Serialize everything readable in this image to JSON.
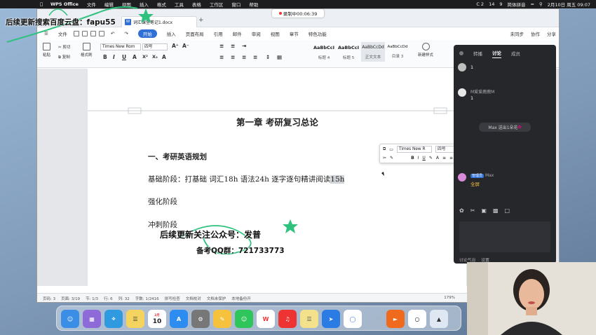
{
  "menubar": {
    "app": "WPS Office",
    "items": [
      "文件",
      "编辑",
      "视图",
      "插入",
      "格式",
      "工具",
      "表格",
      "工作区",
      "窗口",
      "帮助"
    ],
    "right": [
      "C 2",
      "14",
      "9",
      "简体拼音",
      "2月10日 周五 09:07"
    ]
  },
  "recording": "录制中00:06:39",
  "doc_tab": {
    "title": "词汇课堂笔记1.docx"
  },
  "toolbar": {
    "file": "文件",
    "start": "开始",
    "tabs": [
      "插入",
      "页面布局",
      "引用",
      "邮件",
      "审阅",
      "视图",
      "章节",
      "特色功能"
    ],
    "right": [
      "未同步",
      "协作",
      "分享"
    ]
  },
  "ribbon": {
    "paste": "粘贴",
    "cut": "剪切",
    "copy": "复制",
    "format_painter": "格式刷",
    "font": "Times New Rom",
    "size": "四号",
    "styles": [
      {
        "sample": "AaBbCcI",
        "name": "标题 4"
      },
      {
        "sample": "AaBbCcI",
        "name": "标题 5"
      },
      {
        "sample": "AaBbCcDd",
        "name": "正文文本"
      },
      {
        "sample": "AaBbCcDd",
        "name": "目录 3"
      }
    ],
    "new_style": "新建样式"
  },
  "document": {
    "chapter": "第一章  考研复习总论",
    "heading": "一、考研英语规划",
    "line1_pre": "基础阶段：打基础  词汇18h  语法24h  逐字逐句精讲阅读",
    "line1_sel": "15h",
    "line2": "强化阶段",
    "line3": "冲刺阶段"
  },
  "float_toolbar": {
    "font": "Times New R",
    "size": "四号",
    "translate": "翻译"
  },
  "statusbar": {
    "page": "页码: 3",
    "pages": "页面: 3/19",
    "section": "节: 1/3",
    "row": "行: 6",
    "col": "列: 32",
    "words": "字数: 1/2416",
    "spell": "拼写检查",
    "proof": "文档校对",
    "protect": "文档未保护",
    "backup": "本地备份开",
    "zoom": "179%"
  },
  "chat": {
    "tabs": [
      "转播",
      "讨论",
      "成员"
    ],
    "active_tab": "讨论",
    "messages": [
      {
        "name": "",
        "text": "1"
      },
      {
        "name": "M爱爱鹿鹿M",
        "text": "1"
      },
      {
        "name": "Max",
        "text": "全屏"
      }
    ],
    "system": "Max 送出1朵花",
    "badge": "管理员",
    "footer": [
      "讨论气泡",
      "设置"
    ]
  },
  "dock": {
    "calendar_month": "2月",
    "calendar_day": "10"
  },
  "watermark": {
    "top": "后续更新搜索百度云盘：fapu55",
    "mid1": "后续更新关注公众号：发普",
    "mid2": "备考QQ群：721733773"
  },
  "colors": {
    "accent": "#2f6fd6",
    "chat_bg": "#26272b",
    "watermark_stroke": "#2ec27e"
  }
}
